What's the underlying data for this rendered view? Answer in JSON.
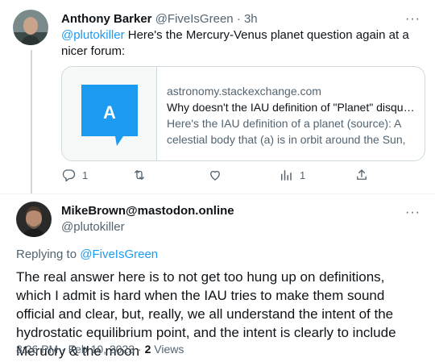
{
  "tweet1": {
    "author_name": "Anthony Barker",
    "author_handle": "@FiveIsGreen",
    "separator": " · ",
    "time": "3h",
    "more": "···",
    "mention": "@plutokiller",
    "text": " Here's the Mercury-Venus planet question again at a nicer forum:",
    "card": {
      "thumb_letter": "A",
      "domain": "astronomy.stackexchange.com",
      "title": "Why doesn't the IAU definition of \"Planet\" disqualify Mercury?",
      "description": "Here's the IAU definition of a planet (source): A celestial body that (a) is in orbit around the Sun, (b) has sufficient mass..."
    },
    "actions": {
      "reply_count": "1",
      "retweet_count": "",
      "like_count": "",
      "views_count": "1"
    }
  },
  "tweet2": {
    "author_name": "MikeBrown@mastodon.online",
    "author_handle": "@plutokiller",
    "more": "···",
    "replying_prefix": "Replying to ",
    "replying_to": "@FiveIsGreen",
    "text": "The real answer here is to not get too hung up on definitions, which I admit is hard when the IAU tries to make them sound official and clear, but, really, we all understand the intent of the hydrostatic equilibrium point, and the intent is clearly to include Merucry & the moon",
    "time": "8:26 PM",
    "date_sep": " · ",
    "date": "Feb 10, 2023",
    "views_sep": " · ",
    "views_count": "2",
    "views_label": " Views"
  },
  "colors": {
    "link": "#1d9bf0",
    "secondary_text": "#536471",
    "thumb_blue": "#1d9bf0",
    "border": "#cfd9de"
  }
}
